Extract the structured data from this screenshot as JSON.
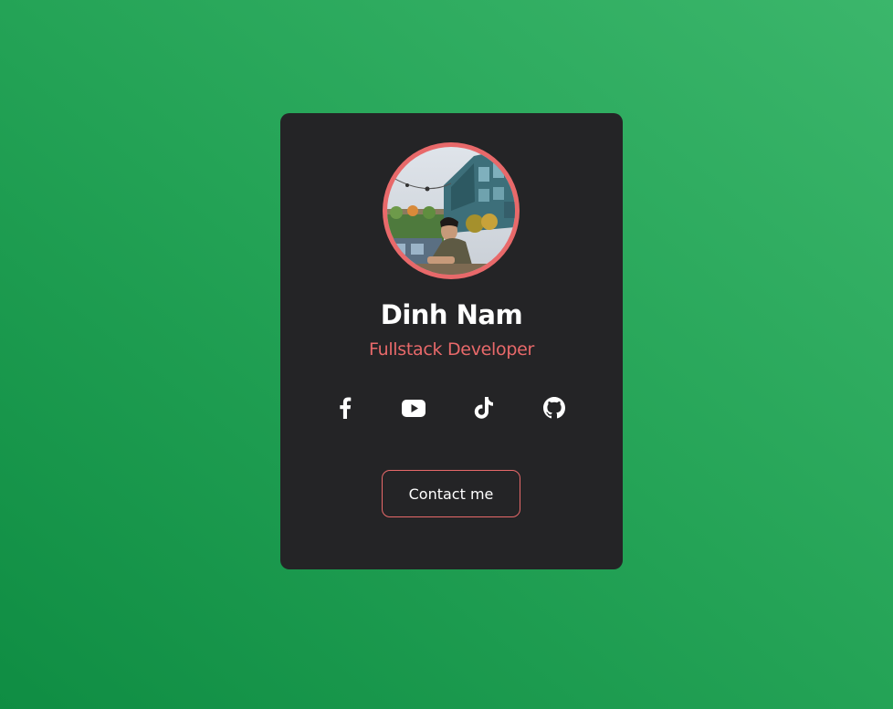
{
  "profile": {
    "name": "Dinh Nam",
    "role": "Fullstack Developer",
    "avatar_alt": "profile photo"
  },
  "social_links": [
    {
      "icon": "facebook-icon"
    },
    {
      "icon": "youtube-icon"
    },
    {
      "icon": "tiktok-icon"
    },
    {
      "icon": "github-icon"
    }
  ],
  "contact_button": {
    "label": "Contact me"
  },
  "colors": {
    "accent": "#e8696a",
    "card_background": "#242426",
    "background_gradient": [
      "#0f8d43",
      "#3bb66b"
    ],
    "text": "#ffffff"
  }
}
